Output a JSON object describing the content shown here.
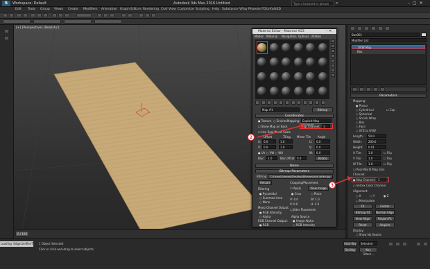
{
  "window": {
    "title": "Autodesk 3ds Max 2016    Untitled",
    "workspace": "Workspace: Default",
    "search_placeholder": "Type a keyword or phrase"
  },
  "menus": [
    "Edit",
    "Tools",
    "Group",
    "Views",
    "Create",
    "Modifiers",
    "Animation",
    "Graph Editors",
    "Rendering",
    "Civil View",
    "Customize",
    "Scripting",
    "Help",
    "Substance",
    "VRay",
    "Phoenix FD",
    "Unfold3D"
  ],
  "viewport": {
    "label": "[+] [Perspective] [Realistic]"
  },
  "material_editor": {
    "title": "Material Editor - Material #23",
    "menu": [
      "Modes",
      "Material",
      "Navigation",
      "Options",
      "Utilities"
    ],
    "slot_name": "Map #1",
    "map_type": "Bitmap",
    "coordinates_header": "Coordinates",
    "texture_label": "Texture",
    "environ_label": "Environ",
    "mapping_label": "Mapping:",
    "mapping_value": "Explicit Map Channel",
    "map_channel_label": "Map Channel:",
    "map_channel_value": "1",
    "show_map_on_back": "Show Map on Back",
    "use_real_world": "Use Real-World Scale",
    "offset_label": "Offset",
    "tiling_label": "Tiling",
    "mirror_tile_label": "Mirror Tile",
    "angle_label": "Angle",
    "u_label": "U:",
    "v_label": "V:",
    "w_label": "W:",
    "u_offset": "0.0",
    "v_offset": "0.0",
    "u_tiling": "1.0",
    "v_tiling": "1.0",
    "u_angle": "0.0",
    "v_angle": "0.0",
    "w_angle": "0.0",
    "uv_label": "UV",
    "vw_label": "VW",
    "wu_label": "WU",
    "blur_label": "Blur:",
    "blur_value": "1.0",
    "blur_offset_label": "Blur offset:",
    "blur_offset_value": "0.0",
    "rotate_button": "Rotate",
    "noise_header": "Noise",
    "bitmap_params_header": "Bitmap Parameters",
    "bitmap_label": "Bitmap:",
    "bitmap_path": "C:\\Users\\Liderwol\\Desktop\\Bitmaps\\oak_white.jpg",
    "reload_button": "Reload",
    "cropping_header": "Cropping/Placement",
    "apply_label": "Apply",
    "view_image_button": "View Image",
    "crop_label": "Crop",
    "place_label": "Place",
    "filtering_label": "Filtering",
    "pyramidal_label": "Pyramidal",
    "summed_area_label": "Summed Area",
    "none_label": "None",
    "mono_channel_label": "Mono Channel Output:",
    "rgb_intensity_label": "RGB Intensity",
    "alpha_label": "Alpha",
    "rgb_channel_label": "RGB Channel Output:",
    "rgb_label": "RGB",
    "alpha_source_label": "Alpha Source",
    "image_alpha_label": "Image Alpha",
    "rgb_intensity_label2": "RGB Intensity",
    "jitter_placement_label": "Jitter Placement:",
    "crop_u": "0.0",
    "crop_v": "0.0",
    "crop_w": "1.0",
    "crop_h": "1.0"
  },
  "right_panel": {
    "object_name": "Box001",
    "modifier_list_label": "Modifier List",
    "stack_items": [
      "UVW Map",
      "Box"
    ],
    "parameters_header": "Parameters",
    "mapping_header": "Mapping:",
    "mapping_options": [
      "Planar",
      "Cylindrical",
      "Spherical",
      "Shrink Wrap",
      "Box",
      "Face",
      "XYZ to UVW"
    ],
    "cap_label": "Cap",
    "length_label": "Length:",
    "length_value": "50.0",
    "width_label": "Width:",
    "width_value": "200.0",
    "height_label": "Height:",
    "height_value": "0.01",
    "u_tile_label": "U Tile:",
    "v_tile_label": "V Tile:",
    "w_tile_label": "W Tile:",
    "tile_value": "1.0",
    "flip_label": "Flip",
    "real_world_label": "Real-World Map Size",
    "channel_header": "Channel:",
    "map_channel_label": "Map Channel:",
    "map_channel_value": "1",
    "vertex_color_label": "Vertex Color Channel",
    "alignment_header": "Alignment:",
    "axes": [
      "X",
      "Y",
      "Z"
    ],
    "manipulate_label": "Manipulate",
    "buttons": [
      "Fit",
      "Center",
      "Bitmap Fit",
      "Normal Align",
      "View Align",
      "Region Fit",
      "Reset",
      "Acquire"
    ],
    "display_header": "Display:",
    "display_options": [
      "Show No Seams",
      "Thin Seam Display",
      "Thick Seam Display"
    ]
  },
  "callouts": [
    "1",
    "2",
    "3"
  ],
  "status": {
    "selected": "1 Object Selected",
    "hint": "Click or click-and-drag to select objects",
    "timeline": "0 / 100",
    "script_line": "Loading: EdgeLineRenTiles",
    "auto_key": "Auto Key",
    "selected_dd": "Selected",
    "set_key": "Set Key",
    "key_filters": "Key Filters..."
  },
  "colors": {
    "accent": "#e33333",
    "wood": "#c4a675"
  }
}
